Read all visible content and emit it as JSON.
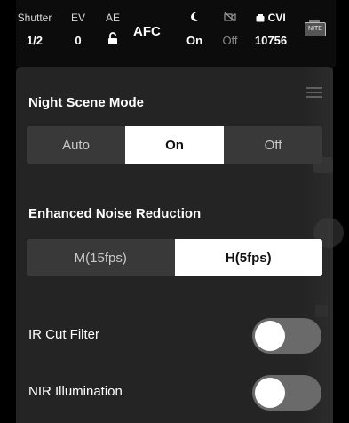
{
  "status_bar": {
    "shutter": {
      "label": "Shutter",
      "value": "1/2"
    },
    "ev": {
      "label": "EV",
      "value": "0"
    },
    "ae": {
      "label": "AE",
      "icon": "lock-open-icon"
    },
    "focus_mode": "AFC",
    "night_mode": {
      "icon": "moon-icon",
      "value": "On"
    },
    "camera_mode": {
      "icon": "camera-off-icon",
      "value": "Off"
    },
    "cvi": {
      "label": "CVI",
      "icon": "storage-icon",
      "value": "10756"
    },
    "battery": {
      "icon": "battery-icon",
      "text": "NITE"
    }
  },
  "panel": {
    "night_scene": {
      "title": "Night Scene Mode",
      "options": [
        "Auto",
        "On",
        "Off"
      ],
      "selected": "On"
    },
    "noise_reduction": {
      "title": "Enhanced Noise Reduction",
      "options": [
        "M(15fps)",
        "H(5fps)"
      ],
      "selected": "H(5fps)"
    },
    "ir_cut_filter": {
      "label": "IR Cut Filter",
      "enabled": false
    },
    "nir_illumination": {
      "label": "NIR Illumination",
      "enabled": false
    }
  }
}
